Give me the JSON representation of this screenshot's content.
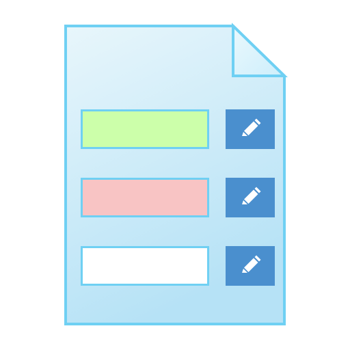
{
  "form_document": {
    "page_fill_top": "#e8f6fb",
    "page_fill_bottom": "#b6e2f6",
    "border_color": "#6fd0f3",
    "fold_fill": "#cdeefb"
  },
  "form_rows": [
    {
      "field_color": "#ccffaa",
      "edit_icon": "pencil-icon",
      "button_color": "#4a8fce"
    },
    {
      "field_color": "#f8c4c4",
      "edit_icon": "pencil-icon",
      "button_color": "#4a8fce"
    },
    {
      "field_color": "#ffffff",
      "edit_icon": "pencil-icon",
      "button_color": "#4a8fce"
    }
  ]
}
